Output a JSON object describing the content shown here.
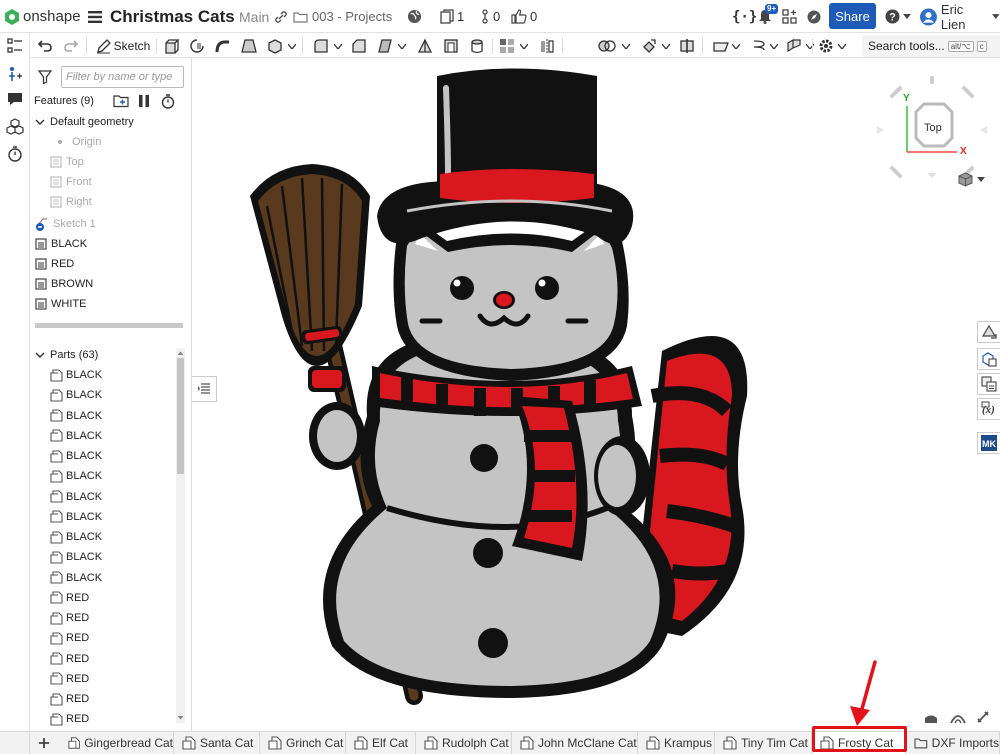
{
  "header": {
    "logo_text": "onshape",
    "doc_title": "Christmas Cats",
    "branch": "Main",
    "folder": "003 - Projects",
    "versions_count": "1",
    "branches_count": "0",
    "likes_count": "0",
    "notifications_badge": "9+",
    "share_label": "Share",
    "user_name": "Eric Lien"
  },
  "toolbar": {
    "sketch_label": "Sketch",
    "search_label": "Search tools...",
    "search_shortcut_1": "alt/⌥",
    "search_shortcut_2": "c"
  },
  "feature_panel": {
    "filter_placeholder": "Filter by name or type",
    "features_header": "Features (9)",
    "default_geometry": "Default geometry",
    "default_items": [
      "Origin",
      "Top",
      "Front",
      "Right"
    ],
    "features": [
      "Sketch 1",
      "BLACK",
      "RED",
      "BROWN",
      "WHITE"
    ],
    "parts_header": "Parts (63)",
    "parts": [
      "BLACK",
      "BLACK",
      "BLACK",
      "BLACK",
      "BLACK",
      "BLACK",
      "BLACK",
      "BLACK",
      "BLACK",
      "BLACK",
      "BLACK",
      "RED",
      "RED",
      "RED",
      "RED",
      "RED",
      "RED",
      "RED"
    ]
  },
  "view_cube": {
    "face_label": "Top",
    "axis_x": "X",
    "axis_y": "Y"
  },
  "tabs": [
    {
      "label": "Gingerbread Cat",
      "type": "part-studio"
    },
    {
      "label": "Santa Cat",
      "type": "part-studio"
    },
    {
      "label": "Grinch Cat",
      "type": "part-studio"
    },
    {
      "label": "Elf Cat",
      "type": "part-studio"
    },
    {
      "label": "Rudolph Cat",
      "type": "part-studio"
    },
    {
      "label": "John McClane Cat",
      "type": "part-studio"
    },
    {
      "label": "Krampus",
      "type": "part-studio"
    },
    {
      "label": "Tiny Tim Cat",
      "type": "part-studio"
    },
    {
      "label": "Frosty Cat",
      "type": "part-studio",
      "active": true,
      "annotated": true
    },
    {
      "label": "DXF Imports",
      "type": "folder"
    }
  ],
  "colors": {
    "accent": "#1e5ab8",
    "annotation": "#e3111b",
    "model_black": "#111111",
    "model_red": "#d8171e",
    "model_brown": "#5a3a1e",
    "model_white": "#c4c4c4"
  }
}
